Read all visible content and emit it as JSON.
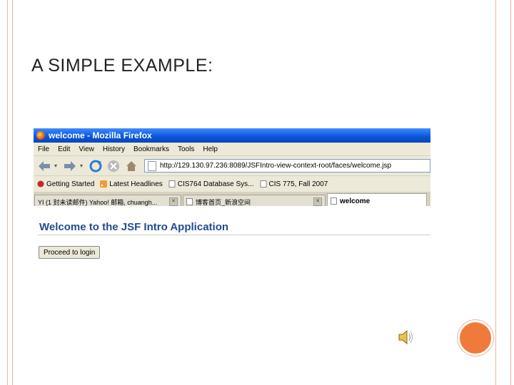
{
  "slide": {
    "title": "A SIMPLE EXAMPLE:"
  },
  "browser": {
    "window_title": "welcome - Mozilla Firefox",
    "menu": [
      "File",
      "Edit",
      "View",
      "History",
      "Bookmarks",
      "Tools",
      "Help"
    ],
    "url": "http://129.130.97.236:8089/JSFIntro-view-context-root/faces/welcome.jsp",
    "bookmarks": [
      {
        "label": "Getting Started",
        "icon": "firefox-bookmark-icon"
      },
      {
        "label": "Latest Headlines",
        "icon": "rss-feed-icon"
      },
      {
        "label": "CIS764 Database Sys...",
        "icon": "page-icon"
      },
      {
        "label": "CIS 775, Fall 2007",
        "icon": "page-icon"
      }
    ],
    "tabs": [
      {
        "label": "YI (1 封未读邮件) Yahoo! 邮箱, chuangh...",
        "active": false
      },
      {
        "label": "博客首页_新浪空间",
        "active": false
      },
      {
        "label": "welcome",
        "active": true
      }
    ],
    "page": {
      "heading": "Welcome to the JSF Intro Application",
      "button_label": "Proceed to login"
    }
  },
  "colors": {
    "accent_border": "#f1b49c",
    "circle": "#f07a3c",
    "heading": "#1f4c8f",
    "titlebar": "#0a55d9"
  }
}
